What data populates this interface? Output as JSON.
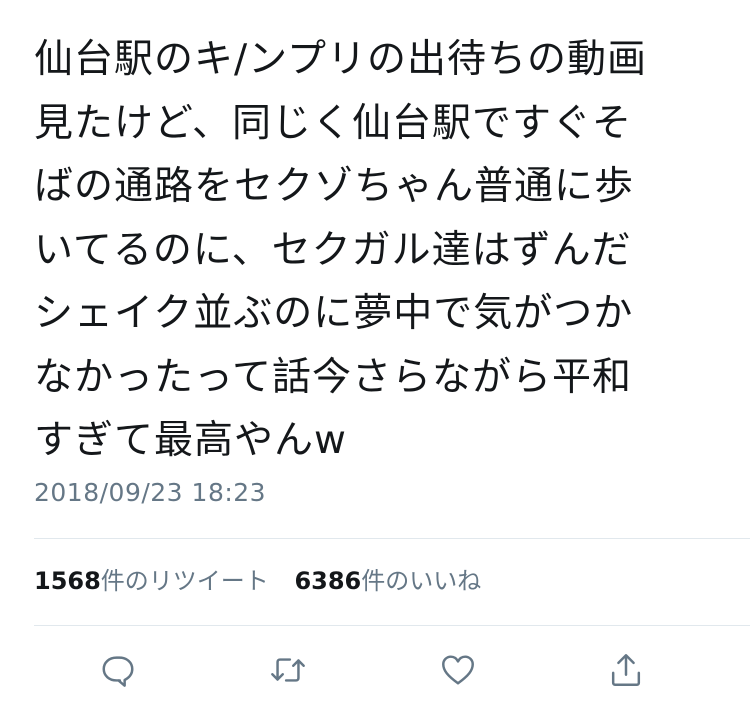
{
  "tweet": {
    "lines": [
      "仙台駅のキ/ンプリの出待ちの動画",
      "見たけど、同じく仙台駅ですぐそ",
      "ばの通路をセクゾちゃん普通に歩",
      "いてるのに、セクガル達はずんだ",
      "シェイク並ぶのに夢中で気がつか",
      "なかったって話今さらながら平和",
      "すぎて最高やんw"
    ],
    "timestamp": "2018/09/23 18:23"
  },
  "stats": {
    "retweet_count": "1568",
    "retweet_label": "件のリツイート",
    "like_count": "6386",
    "like_label": "件のいいね"
  },
  "actions": {
    "icons": [
      "reply-icon",
      "retweet-icon",
      "like-icon",
      "share-icon"
    ],
    "color": "#657786"
  }
}
